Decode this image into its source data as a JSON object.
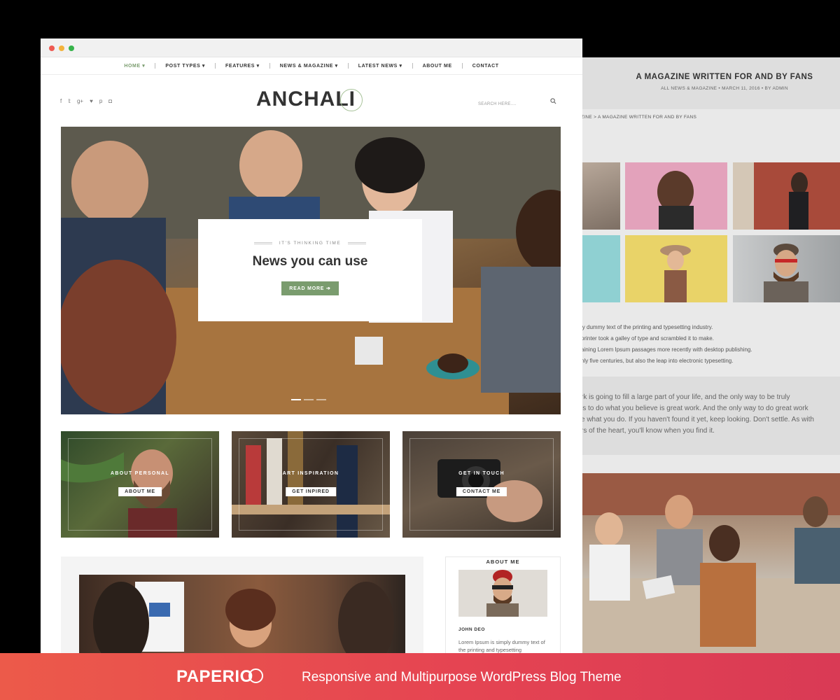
{
  "nav": {
    "items": [
      {
        "label": "HOME",
        "caret": true,
        "active": true
      },
      {
        "label": "POST TYPES",
        "caret": true,
        "active": false
      },
      {
        "label": "FEATURES",
        "caret": true,
        "active": false
      },
      {
        "label": "NEWS & MAGAZINE",
        "caret": true,
        "active": false
      },
      {
        "label": "LATEST NEWS",
        "caret": true,
        "active": false
      },
      {
        "label": "ABOUT ME",
        "caret": false,
        "active": false
      },
      {
        "label": "CONTACT",
        "caret": false,
        "active": false
      }
    ]
  },
  "header": {
    "logo": "ANCHALI",
    "social_icons": [
      "facebook-icon",
      "twitter-icon",
      "google-plus-icon",
      "heart-icon",
      "pinterest-icon",
      "instagram-icon"
    ],
    "social_glyphs": [
      "f",
      "𝕥",
      "g+",
      "♥",
      "p",
      "◘"
    ],
    "search_placeholder": "SEARCH HERE....",
    "search_icon": "⌕"
  },
  "hero": {
    "kicker": "IT'S THINKING TIME",
    "title": "News you can use",
    "button": "READ MORE ➔",
    "slides": 3,
    "active_slide": 1
  },
  "tiles": [
    {
      "caption": "ABOUT PERSONAL",
      "button": "ABOUT ME"
    },
    {
      "caption": "ART INSPIRATION",
      "button": "GET INPIRED"
    },
    {
      "caption": "GET IN TOUCH",
      "button": "CONTACT ME"
    }
  ],
  "sidebar": {
    "heading": "ABOUT ME",
    "name": "JOHN DEO",
    "text": "Lorem Ipsum is simply dummy text of the printing and typesetting"
  },
  "back_page": {
    "title": "A MAGAZINE WRITTEN FOR AND BY FANS",
    "meta": "ALL NEWS & MAGAZINE  •  MARCH 11, 2016  •  BY ADMIN",
    "breadcrumb": "ZINE  >  A MAGAZINE WRITTEN FOR AND BY FANS",
    "paragraph": [
      "ly dummy text of the printing and typesetting industry.",
      "printer took a galley of type and scrambled it to make.",
      "aining Lorem Ipsum passages more recently with desktop publishing.",
      "nly five centuries, but also the leap into electronic typesetting."
    ],
    "quote": [
      "rk is going to fill a large part of your life, and the only way to be truly",
      "is to do what you believe is great work. And the only way to do great work",
      "e what you do. If you haven't found it yet, keep looking. Don't settle. As with",
      "rs of the heart, you'll know when you find it."
    ]
  },
  "banner": {
    "brand": "PAPERIO",
    "tagline": "Responsive and Multipurpose WordPress Blog Theme"
  },
  "colors": {
    "accent_green": "#7a9c6e",
    "banner_red": "#e54452",
    "traffic_red": "#ee5a52",
    "traffic_yellow": "#f3b33c",
    "traffic_green": "#36b34a"
  }
}
